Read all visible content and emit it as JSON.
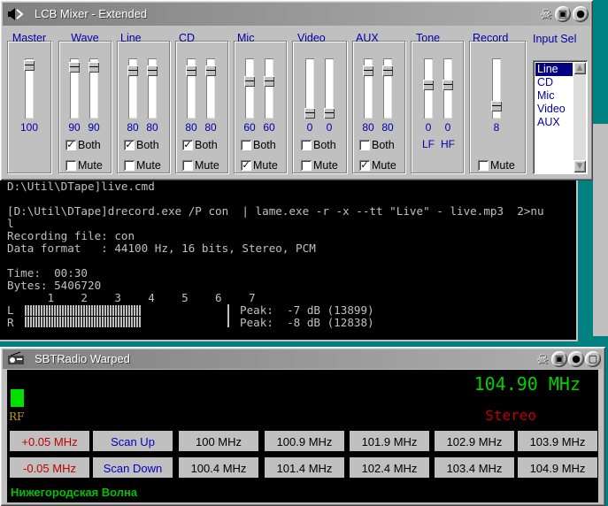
{
  "mixer": {
    "title": "LCB Mixer - Extended",
    "channels": [
      {
        "label": "Master",
        "values": [
          "100"
        ]
      },
      {
        "label": "Wave",
        "values": [
          "90",
          "90"
        ],
        "both": "Both",
        "both_checked": "✓",
        "mute": "Mute",
        "mute_checked": ""
      },
      {
        "label": "Line",
        "values": [
          "80",
          "80"
        ],
        "both": "Both",
        "both_checked": "✓",
        "mute": "Mute",
        "mute_checked": ""
      },
      {
        "label": "CD",
        "values": [
          "80",
          "80"
        ],
        "both": "Both",
        "both_checked": "✓",
        "mute": "Mute",
        "mute_checked": ""
      },
      {
        "label": "Mic",
        "values": [
          "60",
          "60"
        ],
        "both": "Both",
        "both_checked": "",
        "mute": "Mute",
        "mute_checked": "✓"
      },
      {
        "label": "Video",
        "values": [
          "0",
          "0"
        ],
        "both": "Both",
        "both_checked": "",
        "mute": "Mute",
        "mute_checked": ""
      },
      {
        "label": "AUX",
        "values": [
          "80",
          "80"
        ],
        "both": "Both",
        "both_checked": "",
        "mute": "Mute",
        "mute_checked": "✓"
      },
      {
        "label": "Tone",
        "values": [
          "0",
          "0"
        ],
        "sublabels": [
          "LF",
          "HF"
        ]
      },
      {
        "label": "Record",
        "values": [
          "8"
        ],
        "mute": "Mute",
        "mute_checked": ""
      }
    ],
    "input_sel": {
      "label": "Input Sel",
      "options": [
        "Line",
        "CD",
        "Mic",
        "Video",
        "AUX"
      ],
      "selected": "Line"
    }
  },
  "console": {
    "lines": [
      "D:\\Util\\DTape]live.cmd",
      "",
      "[D:\\Util\\DTape]drecord.exe /P con  | lame.exe -r -x --tt \"Live\" - live.mp3  2>nu",
      "l",
      "Recording file: con",
      "Data format   : 44100 Hz, 16 bits, Stereo, PCM",
      "",
      "Time:  00:30",
      "Bytes: 5406720",
      "      1    2    3    4    5    6    7"
    ],
    "meter_l": "L",
    "meter_r": "R",
    "peak_l": "Peak:  -7 dB (13899)",
    "peak_r": "Peak:  -8 dB (12838)"
  },
  "radio": {
    "title": "SBTRadio Warped",
    "frequency": "104.90 MHz",
    "stereo": "Stereo",
    "rf_label": "RF",
    "station": "Нижегородская Волна",
    "buttons_row1": [
      "+0.05 MHz",
      "Scan Up",
      "100 MHz",
      "100.9 MHz",
      "101.9 MHz",
      "102.9 MHz",
      "103.9 MHz"
    ],
    "buttons_row2": [
      "-0.05 MHz",
      "Scan Down",
      "100.4 MHz",
      "101.4 MHz",
      "102.4 MHz",
      "103.4 MHz",
      "104.9 MHz"
    ],
    "colors": {
      "freq": "#00d000",
      "stereo": "#c00000",
      "plus_minus": "#c00000",
      "scan": "#0000c0"
    }
  }
}
